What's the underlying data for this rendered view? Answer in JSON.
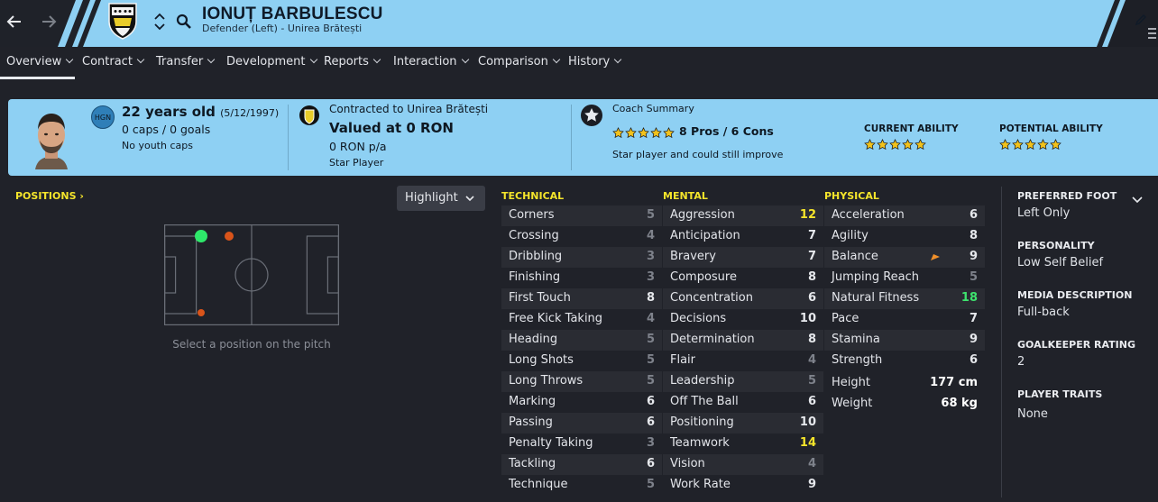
{
  "player": {
    "name": "IONUȚ BARBULESCU",
    "subtitle": "Defender (Left) - Unirea Brătești",
    "nationality_code": "HGN"
  },
  "tabs": [
    {
      "label": "Overview"
    },
    {
      "label": "Contract"
    },
    {
      "label": "Transfer"
    },
    {
      "label": "Development"
    },
    {
      "label": "Reports"
    },
    {
      "label": "Interaction"
    },
    {
      "label": "Comparison"
    },
    {
      "label": "History"
    }
  ],
  "summary": {
    "age": "22 years old",
    "dob": "(5/12/1997)",
    "caps": "0 caps / 0 goals",
    "youth_caps": "No youth caps",
    "contract": "Contracted to Unirea Brătești",
    "value": "Valued at 0 RON",
    "wage": "0 RON p/a",
    "status": "Star Player",
    "coach_title": "Coach Summary",
    "pros_cons": "8 Pros / 6 Cons",
    "coach_note": "Star player and could still improve",
    "coach_stars": 5,
    "current_ability_label": "CURRENT ABILITY",
    "current_ability_stars": 5,
    "potential_ability_label": "POTENTIAL ABILITY",
    "potential_ability_stars": 5
  },
  "positions": {
    "title": "POSITIONS",
    "highlight_label": "Highlight",
    "hint": "Select a position on the pitch",
    "markers": [
      {
        "role": "natural",
        "color": "#2ee86a"
      },
      {
        "role": "unconvincing",
        "color": "#d9541a"
      },
      {
        "role": "unconvincing",
        "color": "#d9541a"
      }
    ]
  },
  "technical": {
    "title": "TECHNICAL",
    "attrs": [
      {
        "label": "Corners",
        "value": "5",
        "tone": "dim"
      },
      {
        "label": "Crossing",
        "value": "4",
        "tone": "dim"
      },
      {
        "label": "Dribbling",
        "value": "3",
        "tone": "dim"
      },
      {
        "label": "Finishing",
        "value": "3",
        "tone": "dim"
      },
      {
        "label": "First Touch",
        "value": "8",
        "tone": ""
      },
      {
        "label": "Free Kick Taking",
        "value": "4",
        "tone": "dim"
      },
      {
        "label": "Heading",
        "value": "5",
        "tone": "dim"
      },
      {
        "label": "Long Shots",
        "value": "5",
        "tone": "dim"
      },
      {
        "label": "Long Throws",
        "value": "5",
        "tone": "dim"
      },
      {
        "label": "Marking",
        "value": "6",
        "tone": ""
      },
      {
        "label": "Passing",
        "value": "6",
        "tone": ""
      },
      {
        "label": "Penalty Taking",
        "value": "3",
        "tone": "dim"
      },
      {
        "label": "Tackling",
        "value": "6",
        "tone": ""
      },
      {
        "label": "Technique",
        "value": "5",
        "tone": "dim"
      }
    ]
  },
  "mental": {
    "title": "MENTAL",
    "attrs": [
      {
        "label": "Aggression",
        "value": "12",
        "tone": "hi"
      },
      {
        "label": "Anticipation",
        "value": "7",
        "tone": ""
      },
      {
        "label": "Bravery",
        "value": "7",
        "tone": ""
      },
      {
        "label": "Composure",
        "value": "8",
        "tone": ""
      },
      {
        "label": "Concentration",
        "value": "6",
        "tone": ""
      },
      {
        "label": "Decisions",
        "value": "10",
        "tone": ""
      },
      {
        "label": "Determination",
        "value": "8",
        "tone": ""
      },
      {
        "label": "Flair",
        "value": "4",
        "tone": "dim"
      },
      {
        "label": "Leadership",
        "value": "5",
        "tone": "dim"
      },
      {
        "label": "Off The Ball",
        "value": "6",
        "tone": ""
      },
      {
        "label": "Positioning",
        "value": "10",
        "tone": ""
      },
      {
        "label": "Teamwork",
        "value": "14",
        "tone": "hi"
      },
      {
        "label": "Vision",
        "value": "4",
        "tone": "dim"
      },
      {
        "label": "Work Rate",
        "value": "9",
        "tone": ""
      }
    ]
  },
  "physical": {
    "title": "PHYSICAL",
    "attrs": [
      {
        "label": "Acceleration",
        "value": "6",
        "tone": ""
      },
      {
        "label": "Agility",
        "value": "8",
        "tone": ""
      },
      {
        "label": "Balance",
        "value": "9",
        "tone": ""
      },
      {
        "label": "Jumping Reach",
        "value": "5",
        "tone": "dim"
      },
      {
        "label": "Natural Fitness",
        "value": "18",
        "tone": "top"
      },
      {
        "label": "Pace",
        "value": "7",
        "tone": ""
      },
      {
        "label": "Stamina",
        "value": "9",
        "tone": ""
      },
      {
        "label": "Strength",
        "value": "6",
        "tone": ""
      }
    ],
    "height_label": "Height",
    "height_value": "177 cm",
    "weight_label": "Weight",
    "weight_value": "68 kg"
  },
  "side": {
    "foot_label": "PREFERRED FOOT",
    "foot_value": "Left Only",
    "personality_label": "PERSONALITY",
    "personality_value": "Low Self Belief",
    "media_label": "MEDIA DESCRIPTION",
    "media_value": "Full-back",
    "gk_label": "GOALKEEPER RATING",
    "gk_value": "2",
    "traits_label": "PLAYER TRAITS",
    "traits_value": "None"
  },
  "colors": {
    "header_blue": "#8ed0f3",
    "attr_yellow": "#f5e52b",
    "attr_green": "#3ee36e",
    "star_gold": "#f2c21b"
  }
}
